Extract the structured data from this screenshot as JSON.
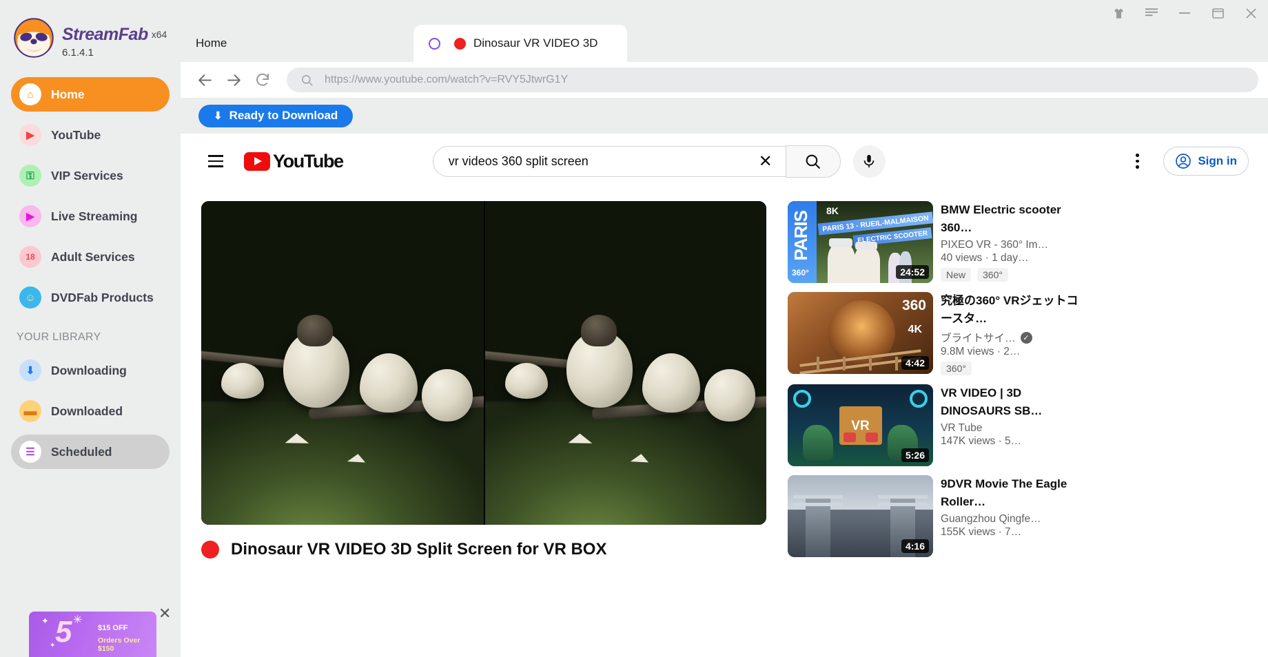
{
  "window": {
    "controls": [
      {
        "name": "shirt-icon",
        "glyph": "♟"
      },
      {
        "name": "menu-icon",
        "glyph": "☰"
      },
      {
        "name": "minimize-icon",
        "glyph": "—"
      },
      {
        "name": "maximize-icon",
        "glyph": "☐"
      },
      {
        "name": "close-icon",
        "glyph": "✕"
      }
    ]
  },
  "sidebar": {
    "brand": {
      "name": "StreamFab",
      "arch": "x64",
      "version": "6.1.4.1"
    },
    "items": [
      {
        "label": "Home",
        "icon": "home-icon",
        "glyph": "⌂",
        "state": "active",
        "bg": "#ffffff",
        "fg": "#f79021"
      },
      {
        "label": "YouTube",
        "icon": "youtube-icon",
        "glyph": "▶",
        "state": "",
        "bg": "#fbdcdc",
        "fg": "#ef4444"
      },
      {
        "label": "VIP Services",
        "icon": "key-icon",
        "glyph": "⚿",
        "state": "",
        "bg": "#aef0b4",
        "fg": "#12a03a"
      },
      {
        "label": "Live Streaming",
        "icon": "video-camera-icon",
        "glyph": "▶",
        "state": "",
        "bg": "#f9b8ee",
        "fg": "#e617d8"
      },
      {
        "label": "Adult Services",
        "icon": "no-eighteen-icon",
        "glyph": "18",
        "state": "",
        "bg": "#fcc9cf",
        "fg": "#ef4657"
      },
      {
        "label": "DVDFab Products",
        "icon": "dvdfab-icon",
        "glyph": "☺",
        "state": "",
        "bg": "#3bb7ee",
        "fg": "#ffe08a"
      }
    ],
    "library_label": "YOUR LIBRARY",
    "library_items": [
      {
        "label": "Downloading",
        "icon": "download-arrow-icon",
        "glyph": "⬇",
        "state": "",
        "bg": "#c7dffb",
        "fg": "#1a7aeb"
      },
      {
        "label": "Downloaded",
        "icon": "folder-icon",
        "glyph": "▬",
        "state": "",
        "bg": "#ffd27a",
        "fg": "#e07a12"
      },
      {
        "label": "Scheduled",
        "icon": "clipboard-icon",
        "glyph": "☰",
        "state": "sel",
        "bg": "#ffffff",
        "fg": "#a347e8"
      }
    ],
    "promo": {
      "number": "5",
      "line1": "$15 OFF",
      "line2": "Orders Over $150",
      "close": "✕"
    }
  },
  "tabs": {
    "home_label": "Home",
    "active_label": "Dinosaur VR VIDEO 3D"
  },
  "chrome": {
    "back": "←",
    "forward": "→",
    "reload": "⟳",
    "url": "https://www.youtube.com/watch?v=RVY5JtwrG1Y",
    "search_icon": "search-icon"
  },
  "download_bar": {
    "label": "Ready to Download",
    "icon": "download-icon"
  },
  "youtube": {
    "logo_text": "YouTube",
    "search_value": "vr videos 360 split screen",
    "search_placeholder": "Search",
    "clear_label": "✕",
    "sign_in_label": "Sign in",
    "mic_icon": "microphone-icon",
    "kebab_icon": "more-vertical-icon"
  },
  "video": {
    "title": "Dinosaur VR VIDEO 3D Split Screen for VR BOX"
  },
  "related": [
    {
      "title": "BMW Electric scooter 360…",
      "channel": "PIXEO VR - 360° Im…",
      "verified": false,
      "stats": "40 views  · 1 day…",
      "duration": "24:52",
      "badges": [
        "New",
        "360°"
      ],
      "thumb": "paris",
      "thumb_texts": {
        "side": "PARIS",
        "quality": "8K",
        "ribbon1": "PARIS 13 - RUEIL-MALMAISON",
        "ribbon2": "ELECTRIC SCOOTER",
        "corner": "360°"
      }
    },
    {
      "title": "究極の360° VRジェットコースタ…",
      "channel": "ブライトサイ…",
      "verified": true,
      "stats": "9.8M views  · 2…",
      "duration": "4:42",
      "badges": [
        "360°"
      ],
      "thumb": "coaster",
      "thumb_texts": {
        "corner": "360",
        "quality": "4K"
      }
    },
    {
      "title": "VR VIDEO | 3D DINOSAURS SB…",
      "channel": "VR Tube",
      "verified": false,
      "stats": "147K views  · 5…",
      "duration": "5:26",
      "badges": [],
      "thumb": "dino",
      "thumb_texts": {
        "center": "VR"
      }
    },
    {
      "title": "9DVR Movie The Eagle Roller…",
      "channel": "Guangzhou Qingfe…",
      "verified": false,
      "stats": "155K views  · 7…",
      "duration": "4:16",
      "badges": [],
      "thumb": "eagle",
      "thumb_texts": {}
    }
  ],
  "colors": {
    "accent_orange": "#f79021",
    "brand_purple": "#5b3e8e",
    "blue_button": "#1a7aeb",
    "youtube_red": "#ef0c0c",
    "tab_red_dot": "#ef2020"
  }
}
